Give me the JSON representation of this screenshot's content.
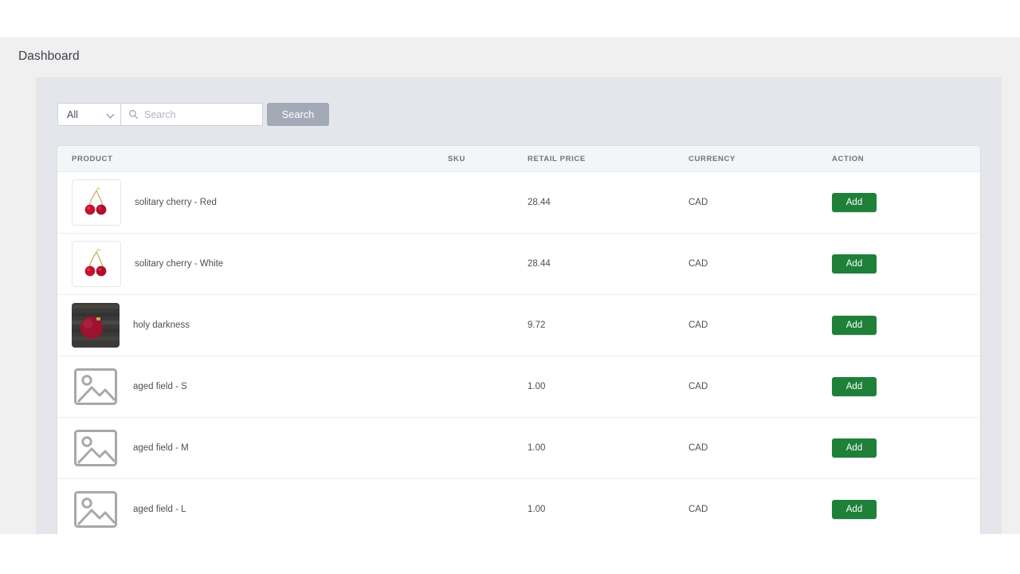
{
  "header": {
    "title": "Dashboard"
  },
  "search": {
    "category_selected": "All",
    "category_icon": "chevron-down-icon",
    "input_value": "",
    "input_placeholder": "Search",
    "input_icon": "search-icon",
    "button_label": "Search",
    "button_color": "#a3a9b6"
  },
  "table": {
    "columns": [
      {
        "key": "product",
        "label": "PRODUCT"
      },
      {
        "key": "sku",
        "label": "SKU"
      },
      {
        "key": "price",
        "label": "RETAIL PRICE"
      },
      {
        "key": "currency",
        "label": "CURRENCY"
      },
      {
        "key": "action",
        "label": "ACTION"
      }
    ],
    "action_label": "Add",
    "action_color": "#1e8039",
    "rows": [
      {
        "name": "solitary cherry - Red",
        "sku": "",
        "price": "28.44",
        "currency": "CAD",
        "action": "Add",
        "thumb": "cherries-image"
      },
      {
        "name": "solitary cherry - White",
        "sku": "",
        "price": "28.44",
        "currency": "CAD",
        "action": "Add",
        "thumb": "cherries-image"
      },
      {
        "name": "holy darkness",
        "sku": "",
        "price": "9.72",
        "currency": "CAD",
        "action": "Add",
        "thumb": "red-ornament-on-wood-image"
      },
      {
        "name": "aged field - S",
        "sku": "",
        "price": "1.00",
        "currency": "CAD",
        "action": "Add",
        "thumb": "image-placeholder-icon"
      },
      {
        "name": "aged field - M",
        "sku": "",
        "price": "1.00",
        "currency": "CAD",
        "action": "Add",
        "thumb": "image-placeholder-icon"
      },
      {
        "name": "aged field - L",
        "sku": "",
        "price": "1.00",
        "currency": "CAD",
        "action": "Add",
        "thumb": "image-placeholder-icon"
      }
    ]
  }
}
